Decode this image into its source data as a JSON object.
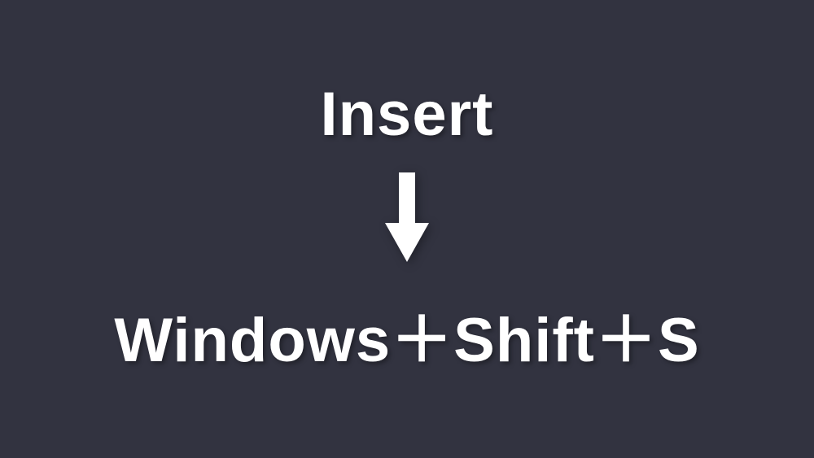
{
  "slide": {
    "top_label": "Insert",
    "bottom_label": "Windows＋Shift＋S"
  }
}
